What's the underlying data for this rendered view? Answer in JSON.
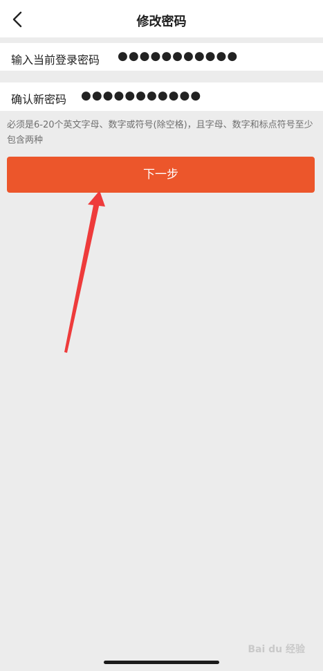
{
  "header": {
    "title": "修改密码",
    "back_icon": "chevron-left-icon"
  },
  "form": {
    "current_password": {
      "label": "输入当前登录密码",
      "value": "●●●●●●●●●●●"
    },
    "new_password": {
      "label": "确认新密码",
      "value": "●●●●●●●●●●●"
    },
    "hint": "必须是6-20个英文字母、数字或符号(除空格)，且字母、数字和标点符号至少包含两种"
  },
  "actions": {
    "next_label": "下一步"
  },
  "watermark": "Bai du 经验",
  "colors": {
    "accent": "#ec562b",
    "annotation_arrow": "#ee3b3b",
    "background": "#ececec"
  }
}
